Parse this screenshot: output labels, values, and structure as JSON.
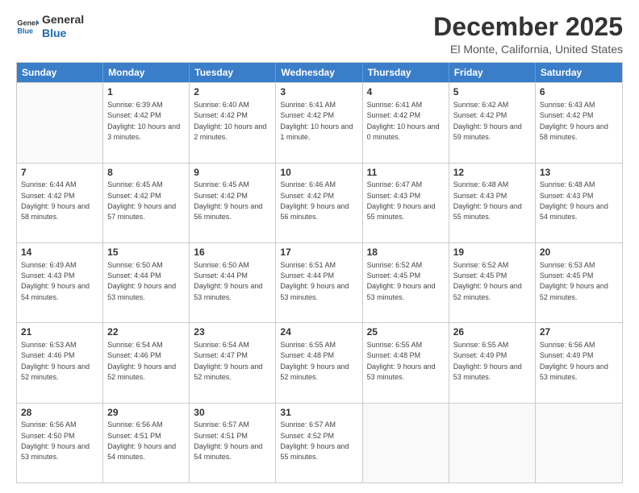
{
  "logo": {
    "general": "General",
    "blue": "Blue"
  },
  "title": "December 2025",
  "subtitle": "El Monte, California, United States",
  "days_of_week": [
    "Sunday",
    "Monday",
    "Tuesday",
    "Wednesday",
    "Thursday",
    "Friday",
    "Saturday"
  ],
  "weeks": [
    [
      {
        "day": "",
        "sunrise": "",
        "sunset": "",
        "daylight": ""
      },
      {
        "day": "1",
        "sunrise": "Sunrise: 6:39 AM",
        "sunset": "Sunset: 4:42 PM",
        "daylight": "Daylight: 10 hours and 3 minutes."
      },
      {
        "day": "2",
        "sunrise": "Sunrise: 6:40 AM",
        "sunset": "Sunset: 4:42 PM",
        "daylight": "Daylight: 10 hours and 2 minutes."
      },
      {
        "day": "3",
        "sunrise": "Sunrise: 6:41 AM",
        "sunset": "Sunset: 4:42 PM",
        "daylight": "Daylight: 10 hours and 1 minute."
      },
      {
        "day": "4",
        "sunrise": "Sunrise: 6:41 AM",
        "sunset": "Sunset: 4:42 PM",
        "daylight": "Daylight: 10 hours and 0 minutes."
      },
      {
        "day": "5",
        "sunrise": "Sunrise: 6:42 AM",
        "sunset": "Sunset: 4:42 PM",
        "daylight": "Daylight: 9 hours and 59 minutes."
      },
      {
        "day": "6",
        "sunrise": "Sunrise: 6:43 AM",
        "sunset": "Sunset: 4:42 PM",
        "daylight": "Daylight: 9 hours and 58 minutes."
      }
    ],
    [
      {
        "day": "7",
        "sunrise": "Sunrise: 6:44 AM",
        "sunset": "Sunset: 4:42 PM",
        "daylight": "Daylight: 9 hours and 58 minutes."
      },
      {
        "day": "8",
        "sunrise": "Sunrise: 6:45 AM",
        "sunset": "Sunset: 4:42 PM",
        "daylight": "Daylight: 9 hours and 57 minutes."
      },
      {
        "day": "9",
        "sunrise": "Sunrise: 6:45 AM",
        "sunset": "Sunset: 4:42 PM",
        "daylight": "Daylight: 9 hours and 56 minutes."
      },
      {
        "day": "10",
        "sunrise": "Sunrise: 6:46 AM",
        "sunset": "Sunset: 4:42 PM",
        "daylight": "Daylight: 9 hours and 56 minutes."
      },
      {
        "day": "11",
        "sunrise": "Sunrise: 6:47 AM",
        "sunset": "Sunset: 4:43 PM",
        "daylight": "Daylight: 9 hours and 55 minutes."
      },
      {
        "day": "12",
        "sunrise": "Sunrise: 6:48 AM",
        "sunset": "Sunset: 4:43 PM",
        "daylight": "Daylight: 9 hours and 55 minutes."
      },
      {
        "day": "13",
        "sunrise": "Sunrise: 6:48 AM",
        "sunset": "Sunset: 4:43 PM",
        "daylight": "Daylight: 9 hours and 54 minutes."
      }
    ],
    [
      {
        "day": "14",
        "sunrise": "Sunrise: 6:49 AM",
        "sunset": "Sunset: 4:43 PM",
        "daylight": "Daylight: 9 hours and 54 minutes."
      },
      {
        "day": "15",
        "sunrise": "Sunrise: 6:50 AM",
        "sunset": "Sunset: 4:44 PM",
        "daylight": "Daylight: 9 hours and 53 minutes."
      },
      {
        "day": "16",
        "sunrise": "Sunrise: 6:50 AM",
        "sunset": "Sunset: 4:44 PM",
        "daylight": "Daylight: 9 hours and 53 minutes."
      },
      {
        "day": "17",
        "sunrise": "Sunrise: 6:51 AM",
        "sunset": "Sunset: 4:44 PM",
        "daylight": "Daylight: 9 hours and 53 minutes."
      },
      {
        "day": "18",
        "sunrise": "Sunrise: 6:52 AM",
        "sunset": "Sunset: 4:45 PM",
        "daylight": "Daylight: 9 hours and 53 minutes."
      },
      {
        "day": "19",
        "sunrise": "Sunrise: 6:52 AM",
        "sunset": "Sunset: 4:45 PM",
        "daylight": "Daylight: 9 hours and 52 minutes."
      },
      {
        "day": "20",
        "sunrise": "Sunrise: 6:53 AM",
        "sunset": "Sunset: 4:45 PM",
        "daylight": "Daylight: 9 hours and 52 minutes."
      }
    ],
    [
      {
        "day": "21",
        "sunrise": "Sunrise: 6:53 AM",
        "sunset": "Sunset: 4:46 PM",
        "daylight": "Daylight: 9 hours and 52 minutes."
      },
      {
        "day": "22",
        "sunrise": "Sunrise: 6:54 AM",
        "sunset": "Sunset: 4:46 PM",
        "daylight": "Daylight: 9 hours and 52 minutes."
      },
      {
        "day": "23",
        "sunrise": "Sunrise: 6:54 AM",
        "sunset": "Sunset: 4:47 PM",
        "daylight": "Daylight: 9 hours and 52 minutes."
      },
      {
        "day": "24",
        "sunrise": "Sunrise: 6:55 AM",
        "sunset": "Sunset: 4:48 PM",
        "daylight": "Daylight: 9 hours and 52 minutes."
      },
      {
        "day": "25",
        "sunrise": "Sunrise: 6:55 AM",
        "sunset": "Sunset: 4:48 PM",
        "daylight": "Daylight: 9 hours and 53 minutes."
      },
      {
        "day": "26",
        "sunrise": "Sunrise: 6:55 AM",
        "sunset": "Sunset: 4:49 PM",
        "daylight": "Daylight: 9 hours and 53 minutes."
      },
      {
        "day": "27",
        "sunrise": "Sunrise: 6:56 AM",
        "sunset": "Sunset: 4:49 PM",
        "daylight": "Daylight: 9 hours and 53 minutes."
      }
    ],
    [
      {
        "day": "28",
        "sunrise": "Sunrise: 6:56 AM",
        "sunset": "Sunset: 4:50 PM",
        "daylight": "Daylight: 9 hours and 53 minutes."
      },
      {
        "day": "29",
        "sunrise": "Sunrise: 6:56 AM",
        "sunset": "Sunset: 4:51 PM",
        "daylight": "Daylight: 9 hours and 54 minutes."
      },
      {
        "day": "30",
        "sunrise": "Sunrise: 6:57 AM",
        "sunset": "Sunset: 4:51 PM",
        "daylight": "Daylight: 9 hours and 54 minutes."
      },
      {
        "day": "31",
        "sunrise": "Sunrise: 6:57 AM",
        "sunset": "Sunset: 4:52 PM",
        "daylight": "Daylight: 9 hours and 55 minutes."
      },
      {
        "day": "",
        "sunrise": "",
        "sunset": "",
        "daylight": ""
      },
      {
        "day": "",
        "sunrise": "",
        "sunset": "",
        "daylight": ""
      },
      {
        "day": "",
        "sunrise": "",
        "sunset": "",
        "daylight": ""
      }
    ]
  ]
}
